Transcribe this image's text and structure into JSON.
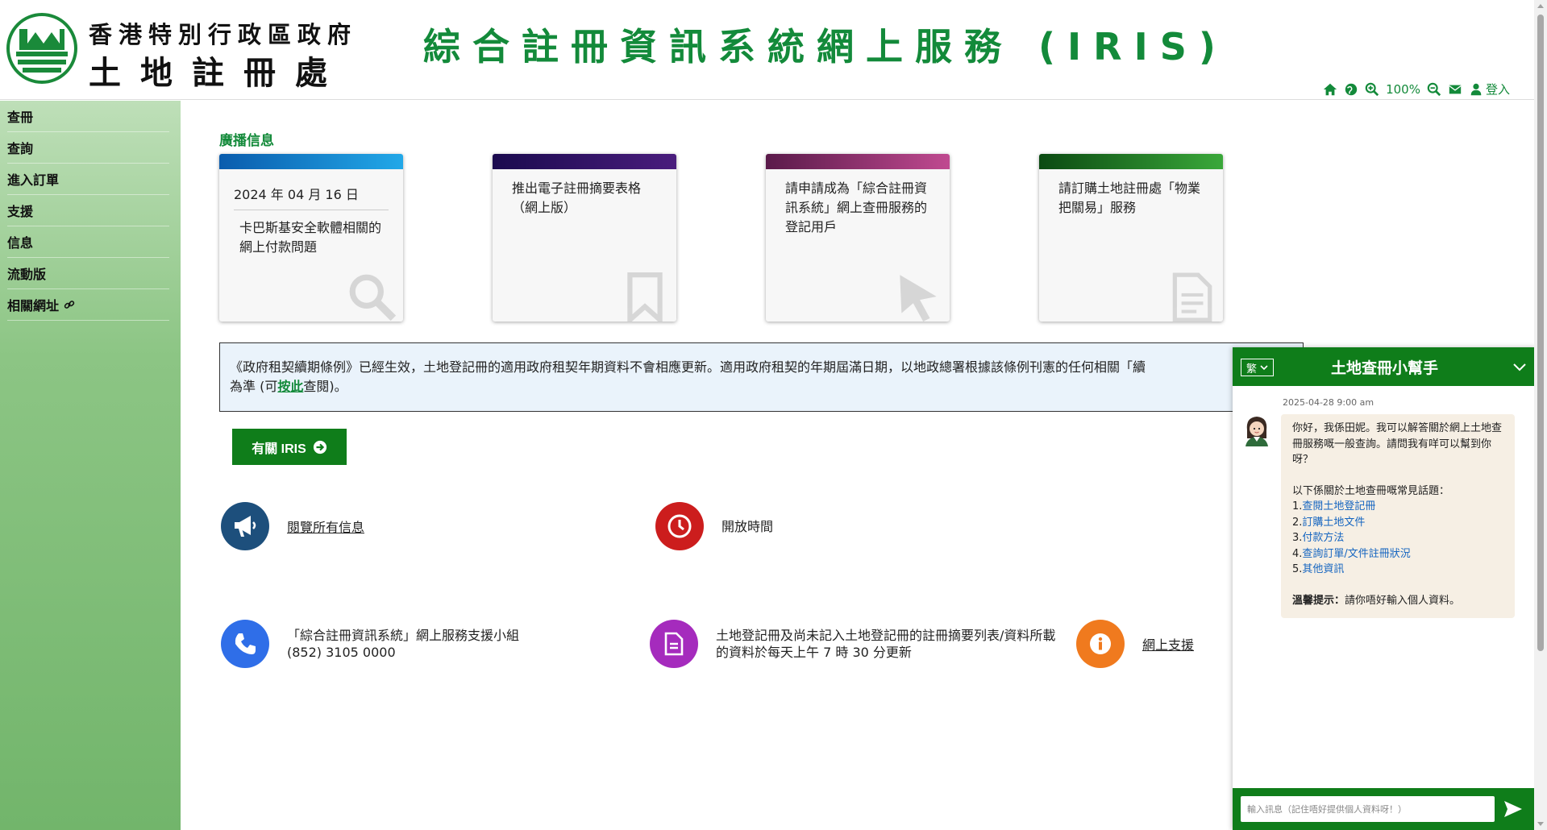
{
  "header": {
    "dept_line1": "香港特別行政區政府",
    "dept_line2": "土地註冊處",
    "system_title": "綜合註冊資訊系統網上服務 (IRIS)",
    "zoom": "100%",
    "login_label": "登入"
  },
  "sidebar": {
    "items": [
      {
        "label": "查冊"
      },
      {
        "label": "查詢"
      },
      {
        "label": "進入訂單"
      },
      {
        "label": "支援"
      },
      {
        "label": "信息"
      },
      {
        "label": "流動版"
      },
      {
        "label": "相關網址"
      }
    ]
  },
  "broadcast": {
    "title": "廣播信息",
    "cards": [
      {
        "date": "2024 年 04 月 16 日",
        "text": "卡巴斯基安全軟體相關的網上付款問題",
        "bar_color": "linear-gradient(90deg,#0a5cad,#22a8e8)",
        "icon": "search-icon"
      },
      {
        "text": "推出電子註冊摘要表格（網上版）",
        "bar_color": "linear-gradient(90deg,#1a0a4e,#4a1d7d)",
        "icon": "bookmark-icon"
      },
      {
        "text": "請申請成為「綜合註冊資訊系統」網上查冊服務的登記用戶",
        "bar_color": "linear-gradient(90deg,#5a1a4a,#c04a90)",
        "icon": "pointer-icon"
      },
      {
        "text": "請訂購土地註冊處「物業把關易」服務",
        "bar_color": "linear-gradient(90deg,#0b4a12,#3aa83a)",
        "icon": "document-icon"
      }
    ]
  },
  "notice": {
    "text_before": "《政府租契續期條例》已經生效，土地登記冊的適用政府租契年期資料不會相應更新。適用政府租契的年期屆滿日期，以地政總署根據該條例刊憲的任何相關「續",
    "text_line2_before": "為準 (可",
    "link": "按此",
    "text_after": "查閱)。"
  },
  "about_button": "有關 IRIS",
  "info": {
    "all_messages": "閱覽所有信息",
    "opening_hours": "開放時間",
    "support_team": "「綜合註冊資訊系統」網上服務支援小組",
    "phone": "(852) 3105 0000",
    "update_note_line1": "土地登記冊及尚未記入土地登記冊的註冊摘要列表/資料所載",
    "update_note_line2": "的資料於每天上午 7 時 30 分更新",
    "online_support": "網上支援"
  },
  "chat": {
    "lang": "繁",
    "title": "土地查冊小幫手",
    "timestamp": "2025-04-28 9:00 am",
    "greeting": "你好，我係田妮。我可以解答關於網上土地查冊服務嘅一般查詢。請問我有咩可以幫到你呀？",
    "topics_intro": "以下係關於土地查冊嘅常見話題：",
    "topics": [
      "查閱土地登記冊",
      "訂購土地文件",
      "付款方法",
      "查詢訂單/文件註冊狀況",
      "其他資訊"
    ],
    "tip_label": "溫馨提示：",
    "tip_text": "請你唔好輸入個人資料。",
    "input_placeholder": "輸入訊息（記住唔好提供個人資料呀！）"
  },
  "colors": {
    "brand_green": "#138a3a",
    "button_green": "#0f7d1a",
    "notice_bg": "#eaf3fb"
  }
}
